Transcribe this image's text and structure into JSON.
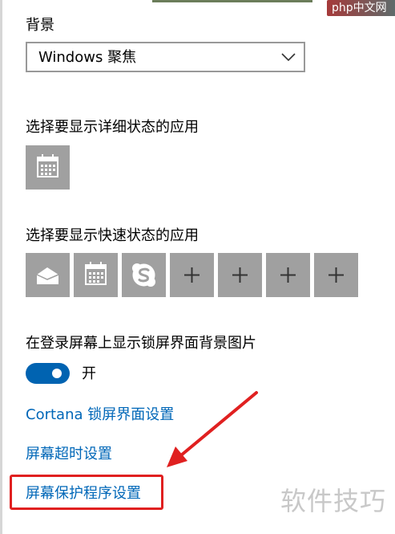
{
  "watermark_top": "php中文网",
  "background_section": {
    "title": "背景",
    "selected_value": "Windows 聚焦"
  },
  "detail_status_section": {
    "title": "选择要显示详细状态的应用",
    "apps": [
      {
        "icon": "calendar-icon"
      }
    ]
  },
  "quick_status_section": {
    "title": "选择要显示快速状态的应用",
    "apps": [
      {
        "icon": "mail-icon"
      },
      {
        "icon": "calendar-icon"
      },
      {
        "icon": "skype-icon"
      },
      {
        "icon": "plus-icon"
      },
      {
        "icon": "plus-icon"
      },
      {
        "icon": "plus-icon"
      },
      {
        "icon": "plus-icon"
      }
    ]
  },
  "login_background": {
    "title": "在登录屏幕上显示锁屏界面背景图片",
    "state": "开",
    "on": true
  },
  "links": {
    "cortana": "Cortana 锁屏界面设置",
    "timeout": "屏幕超时设置",
    "screensaver": "屏幕保护程序设置"
  },
  "watermark_bottom": "软件技巧",
  "colors": {
    "accent": "#0063b1",
    "link": "#0067b8",
    "tile": "#a0a0a0",
    "annotation": "#e02020"
  }
}
